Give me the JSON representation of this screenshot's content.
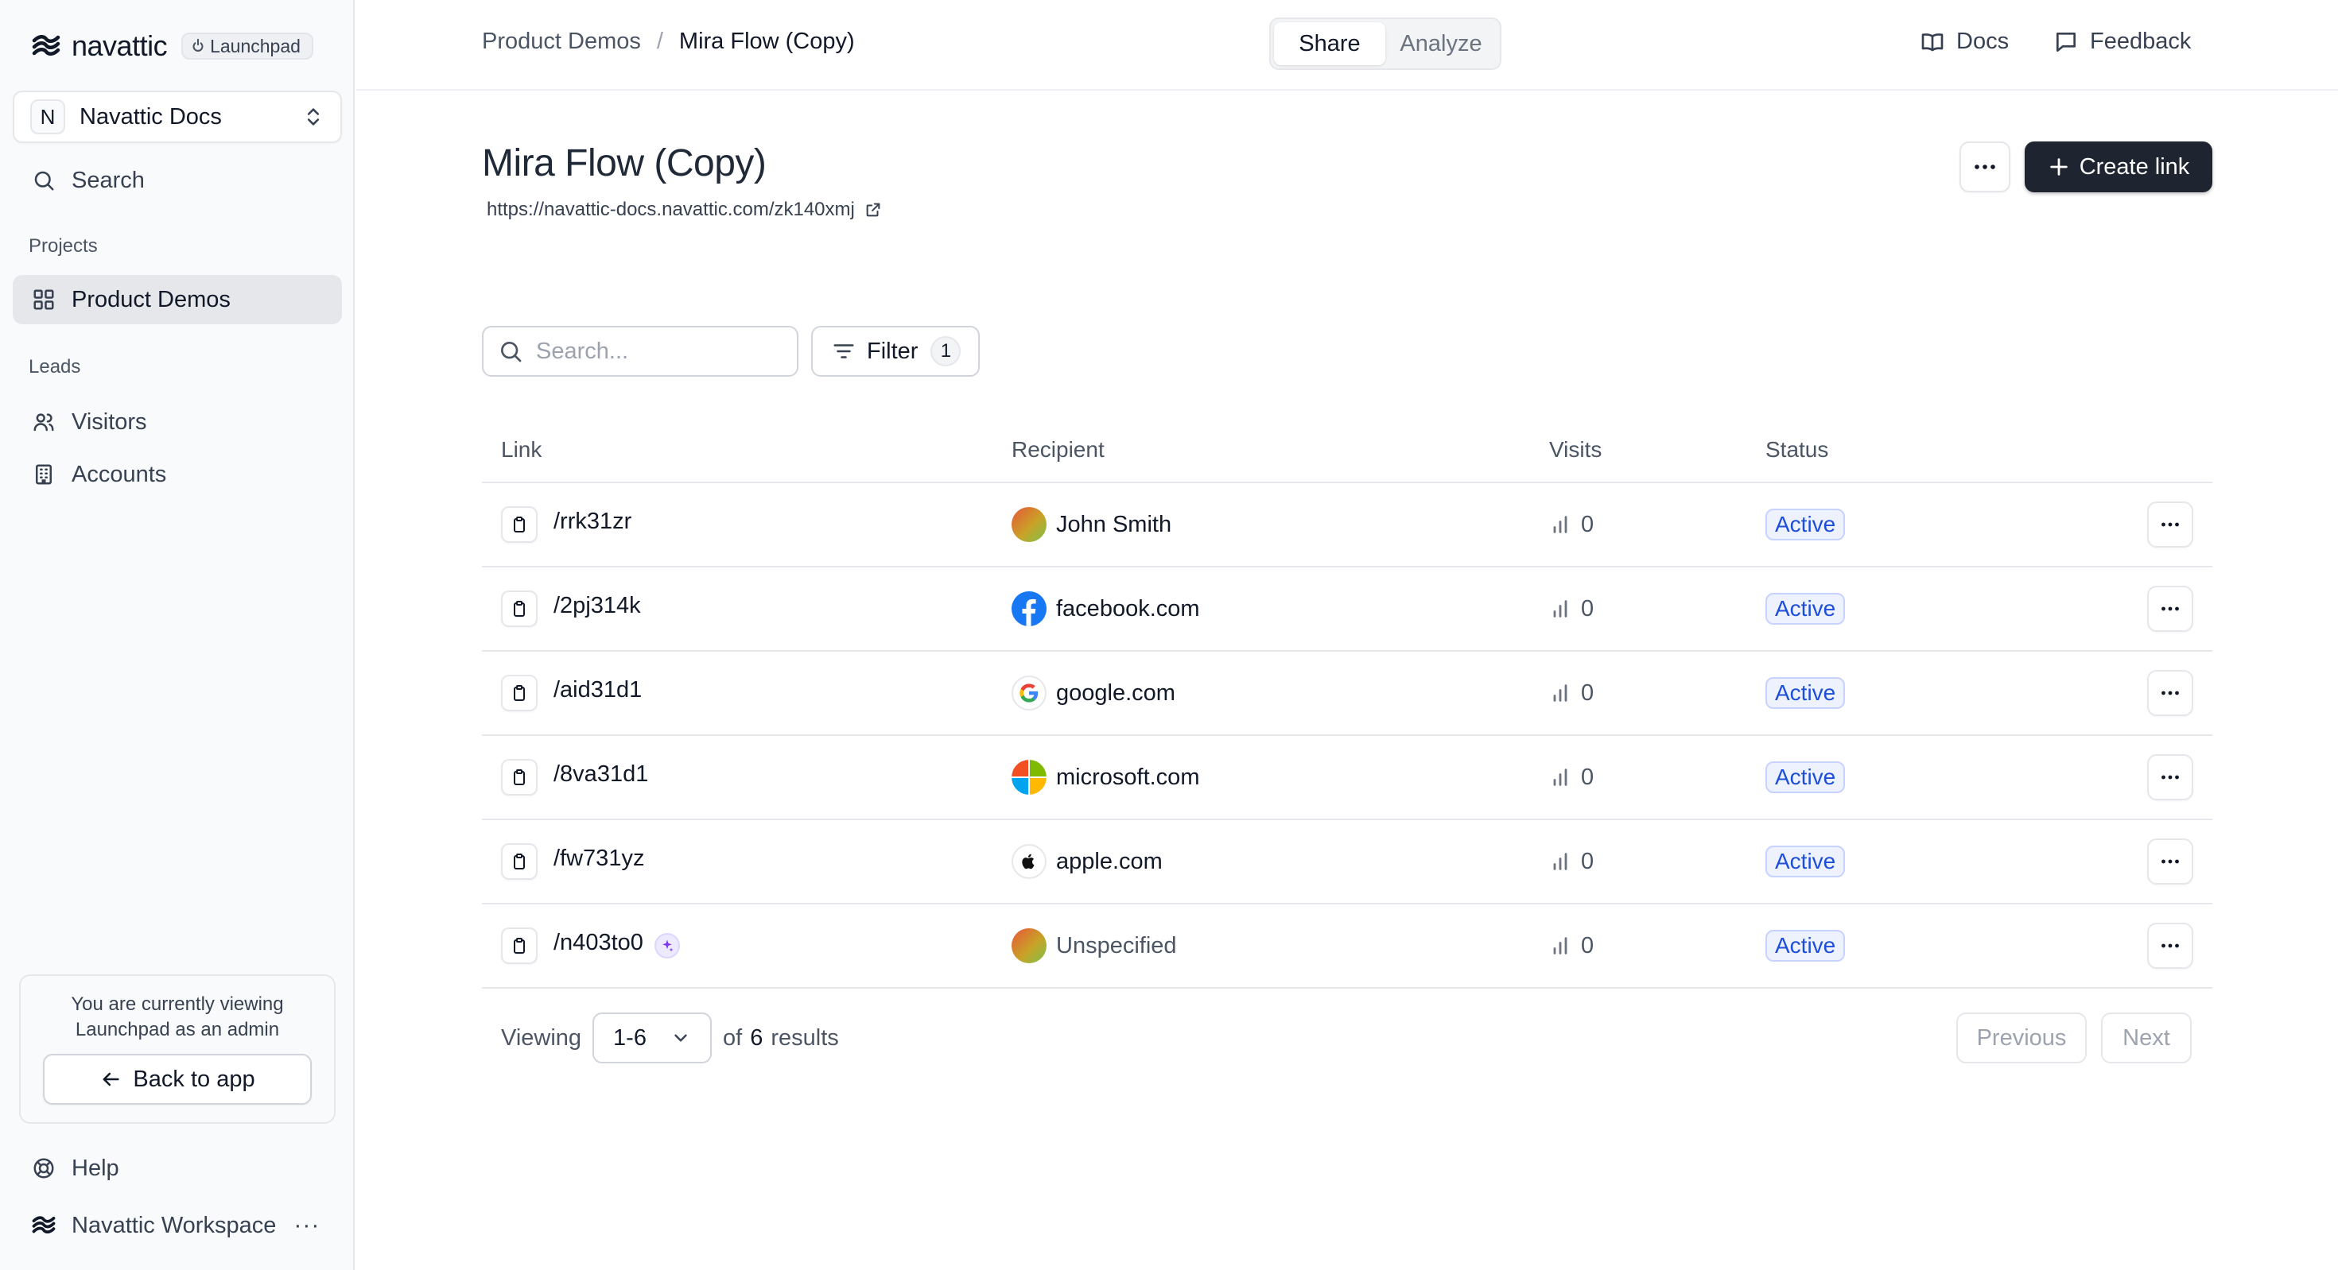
{
  "brand": {
    "name": "navattic",
    "badge": "Launchpad"
  },
  "workspace": {
    "initial": "N",
    "name": "Navattic Docs"
  },
  "sidebar": {
    "search_label": "Search",
    "projects_heading": "Projects",
    "product_demos": "Product Demos",
    "leads_heading": "Leads",
    "visitors": "Visitors",
    "accounts": "Accounts",
    "admin_notice": "You are currently viewing Launchpad as an admin",
    "back_to_app": "Back to app",
    "help": "Help",
    "workspace_footer": "Navattic Workspace",
    "workspace_more": "···"
  },
  "topbar": {
    "breadcrumb_parent": "Product Demos",
    "breadcrumb_sep": "/",
    "breadcrumb_current": "Mira Flow (Copy)",
    "tab_share": "Share",
    "tab_analyze": "Analyze",
    "docs": "Docs",
    "feedback": "Feedback"
  },
  "page": {
    "title": "Mira Flow (Copy)",
    "url": "https://navattic-docs.navattic.com/zk140xmj",
    "create_link": "Create link",
    "search_placeholder": "Search...",
    "filter_label": "Filter",
    "filter_count": "1"
  },
  "table": {
    "headers": {
      "link": "Link",
      "recipient": "Recipient",
      "visits": "Visits",
      "status": "Status"
    },
    "rows": [
      {
        "link": "/rrk31zr",
        "recipient": "John Smith",
        "icon": "gradient-avatar",
        "visits": "0",
        "status": "Active"
      },
      {
        "link": "/2pj314k",
        "recipient": "facebook.com",
        "icon": "facebook-logo",
        "visits": "0",
        "status": "Active"
      },
      {
        "link": "/aid31d1",
        "recipient": "google.com",
        "icon": "google-logo",
        "visits": "0",
        "status": "Active"
      },
      {
        "link": "/8va31d1",
        "recipient": "microsoft.com",
        "icon": "microsoft-logo",
        "visits": "0",
        "status": "Active"
      },
      {
        "link": "/fw731yz",
        "recipient": "apple.com",
        "icon": "apple-logo",
        "visits": "0",
        "status": "Active"
      },
      {
        "link": "/n403to0",
        "recipient": "Unspecified",
        "icon": "gradient-avatar",
        "visits": "0",
        "status": "Active"
      }
    ]
  },
  "pagination": {
    "viewing_label": "Viewing",
    "range": "1-6",
    "of_label": "of",
    "total": "6",
    "results_label": "results",
    "previous": "Previous",
    "next": "Next"
  },
  "colors": {
    "primary_button": "#1f2530",
    "status_text": "#1d4ed8",
    "status_bg": "#eef2ff",
    "sidebar_bg": "#f9fafb"
  }
}
